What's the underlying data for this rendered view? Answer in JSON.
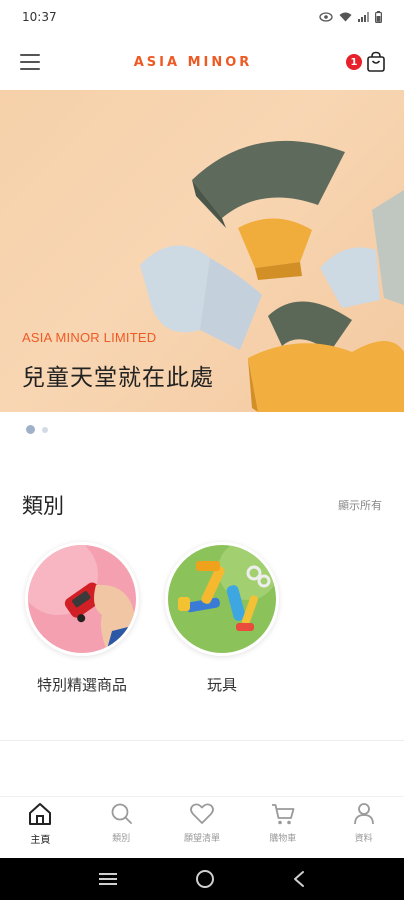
{
  "status_bar": {
    "time": "10:37"
  },
  "header": {
    "brand": "ASIA MINOR",
    "cart_count": "1"
  },
  "hero": {
    "kicker": "ASIA MINOR LIMITED",
    "title": "兒童天堂就在此處",
    "slides": 2,
    "active_slide": 1
  },
  "categories": {
    "title": "類別",
    "show_all": "顯示所有",
    "items": [
      {
        "label": "特別精選商品"
      },
      {
        "label": "玩具"
      }
    ]
  },
  "bottom_nav": {
    "items": [
      {
        "label": "主頁",
        "icon": "home-icon",
        "active": true
      },
      {
        "label": "類別",
        "icon": "search-icon",
        "active": false
      },
      {
        "label": "願望清單",
        "icon": "heart-icon",
        "active": false
      },
      {
        "label": "購物車",
        "icon": "cart-icon",
        "active": false
      },
      {
        "label": "資料",
        "icon": "person-icon",
        "active": false
      }
    ]
  },
  "colors": {
    "brand": "#ee5a24",
    "badge": "#e8202a",
    "hero_bg": "#f6d1aa"
  }
}
